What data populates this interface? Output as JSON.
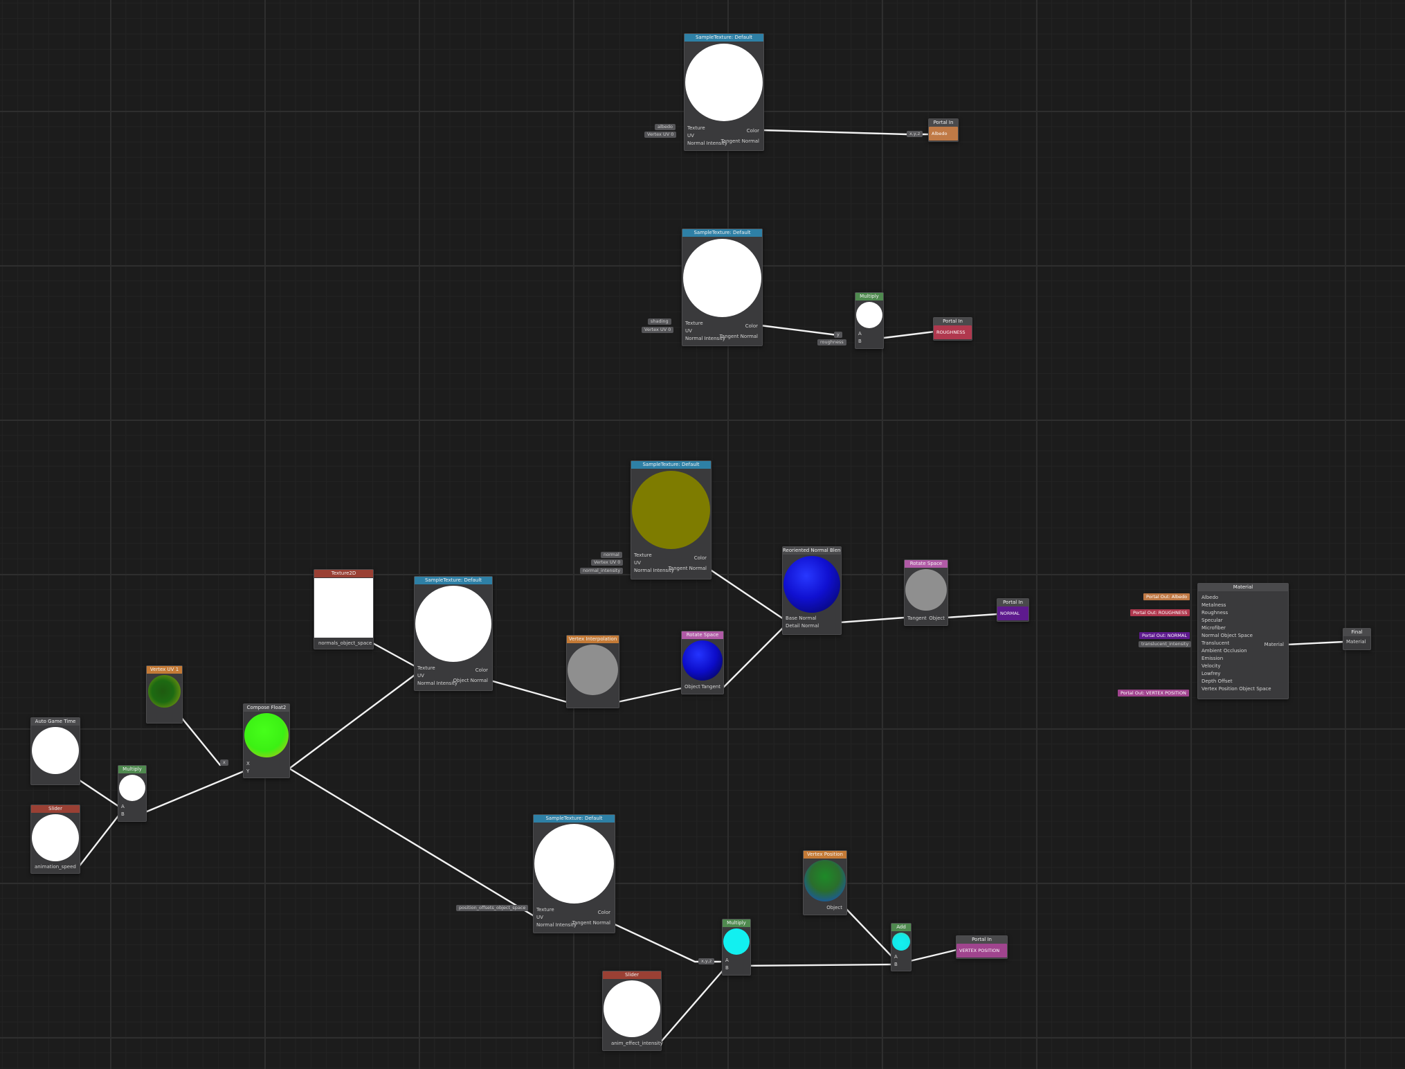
{
  "colors": {
    "sample_texture_header": "#2e80a6",
    "multiply_header": "#4f8a4f",
    "rotate_space_header": "#b05aa6",
    "portal_albedo": "#c07a46",
    "portal_roughness": "#b0384e",
    "portal_normal": "#5e1a8e",
    "portal_vertex": "#a0448e",
    "slider_header": "#9a4034",
    "vertex_header": "#c47a36"
  },
  "nodes": {
    "tex_albedo": {
      "title": "SampleTexture: Default",
      "inputs": [
        "Texture",
        "UV",
        "Normal Intensity"
      ],
      "outputs": [
        "Color",
        "Tangent Normal"
      ],
      "fields": [
        "albedo",
        "Vertex UV 0"
      ]
    },
    "portal_albedo": {
      "title": "Portal In",
      "label": "Albedo",
      "pin": "x,y,z"
    },
    "tex_shading": {
      "title": "SampleTexture: Default",
      "inputs": [
        "Texture",
        "UV",
        "Normal Intensity"
      ],
      "outputs": [
        "Color",
        "Tangent Normal"
      ],
      "fields": [
        "shading",
        "Vertex UV 0"
      ]
    },
    "multiply_rough": {
      "title": "Multiply",
      "inputs": [
        "A",
        "B"
      ],
      "fields": [
        "y",
        "roughness"
      ]
    },
    "portal_rough": {
      "title": "Portal In",
      "label": "ROUGHNESS"
    },
    "tex_normal": {
      "title": "SampleTexture: Default",
      "inputs": [
        "Texture",
        "UV",
        "Normal Intensity"
      ],
      "outputs": [
        "Color",
        "Tangent Normal"
      ],
      "fields": [
        "normal",
        "Vertex UV 0",
        "normal_intensity"
      ]
    },
    "reoriented": {
      "title": "Reoriented Normal Blend",
      "inputs": [
        "Base Normal",
        "Detail Normal"
      ]
    },
    "rotate_space_1": {
      "title": "Rotate Space",
      "inputs": [
        "Tangent"
      ],
      "outputs": [
        "Object"
      ]
    },
    "portal_normal": {
      "title": "Portal In",
      "label": "NORMAL"
    },
    "material": {
      "title": "Material",
      "inputs": [
        "Albedo",
        "Metalness",
        "Roughness",
        "Specular",
        "Microfiber",
        "Normal Object Space",
        "Translucent",
        "Ambient Occlusion",
        "Emission",
        "Velocity",
        "Lowfrey",
        "Depth Offset",
        "Vertex Position Object Space"
      ],
      "output": "Material",
      "portals": [
        "Portal Out: Albedo",
        "Portal Out: ROUGHNESS",
        "Portal Out: NORMAL",
        "translucent_intensity",
        "Portal Out: VERTEX POSITION"
      ]
    },
    "final": {
      "title": "Final",
      "input": "Material"
    },
    "texture2d": {
      "title": "Texture2D",
      "field": "normals_object_space"
    },
    "tex_normals_obj": {
      "title": "SampleTexture: Default",
      "inputs": [
        "Texture",
        "UV",
        "Normal Intensity"
      ],
      "outputs": [
        "Color",
        "Object Normal"
      ]
    },
    "vertex_interp": {
      "title": "Vertex Interpolation"
    },
    "rotate_space_2": {
      "title": "Rotate Space",
      "inputs": [
        "Object"
      ],
      "outputs": [
        "Tangent"
      ]
    },
    "vertex_uv1": {
      "title": "Vertex UV 1"
    },
    "compose": {
      "title": "Compose Float2",
      "inputs": [
        "X",
        "Y"
      ],
      "field": "x"
    },
    "game_time": {
      "title": "Auto Game Time"
    },
    "multiply_time": {
      "title": "Multiply",
      "inputs": [
        "A",
        "B"
      ]
    },
    "slider_speed": {
      "title": "Slider",
      "label": "animation_speed"
    },
    "tex_position": {
      "title": "SampleTexture: Default",
      "inputs": [
        "Texture",
        "UV",
        "Normal Intensity"
      ],
      "outputs": [
        "Color",
        "Tangent Normal"
      ],
      "fields": [
        "position_offsets_object_space"
      ]
    },
    "multiply_pos": {
      "title": "Multiply",
      "inputs": [
        "A",
        "B"
      ],
      "field": "x,y,z"
    },
    "slider_effect": {
      "title": "Slider",
      "label": "anim_effect_intensity"
    },
    "vertex_position": {
      "title": "Vertex Position",
      "output": "Object"
    },
    "add": {
      "title": "Add",
      "inputs": [
        "A",
        "B"
      ]
    },
    "portal_vertex": {
      "title": "Portal In",
      "label": "VERTEX POSITION"
    }
  }
}
